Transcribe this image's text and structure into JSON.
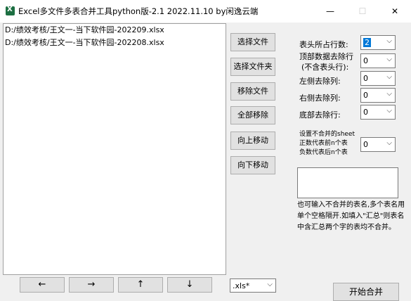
{
  "window": {
    "title": "Excel多文件多表合并工具python版-2.1 2022.11.10 by闲逸云端",
    "minimize": "—",
    "maximize": "☐",
    "close": "✕"
  },
  "files": [
    "D:/绩效考核/王文一-当下软件园-202209.xlsx",
    "D:/绩效考核/王文一-当下软件园-202208.xlsx"
  ],
  "side_buttons": {
    "select_file": "选择文件",
    "select_folder": "选择文件夹",
    "remove_file": "移除文件",
    "remove_all": "全部移除",
    "move_up": "向上移动",
    "move_down": "向下移动"
  },
  "options": {
    "header_rows_label": "表头所占行数:",
    "header_rows_value": "2",
    "top_rows_label_1": "顶部数据去除行",
    "top_rows_label_2": "(不含表头行):",
    "top_rows_value": "0",
    "left_cols_label": "左侧去除列:",
    "left_cols_value": "0",
    "right_cols_label": "右侧去除列:",
    "right_cols_value": "0",
    "bottom_rows_label": "底部去除行:",
    "bottom_rows_value": "0",
    "skip_sheets_label_1": "设置不合并的sheet",
    "skip_sheets_label_2": "正数代表前n个表",
    "skip_sheets_label_3": "负数代表后n个表",
    "skip_sheets_value": "0"
  },
  "note": "也可输入不合并的表名,多个表名用单个空格隔开.如填入\"汇总\"则表名中含汇总两个字的表均不合并。",
  "bottom": {
    "left_arrow": "←",
    "right_arrow": "→",
    "up_arrow": "↑",
    "down_arrow": "↓",
    "format_value": ".xls*",
    "start_merge": "开始合并"
  }
}
